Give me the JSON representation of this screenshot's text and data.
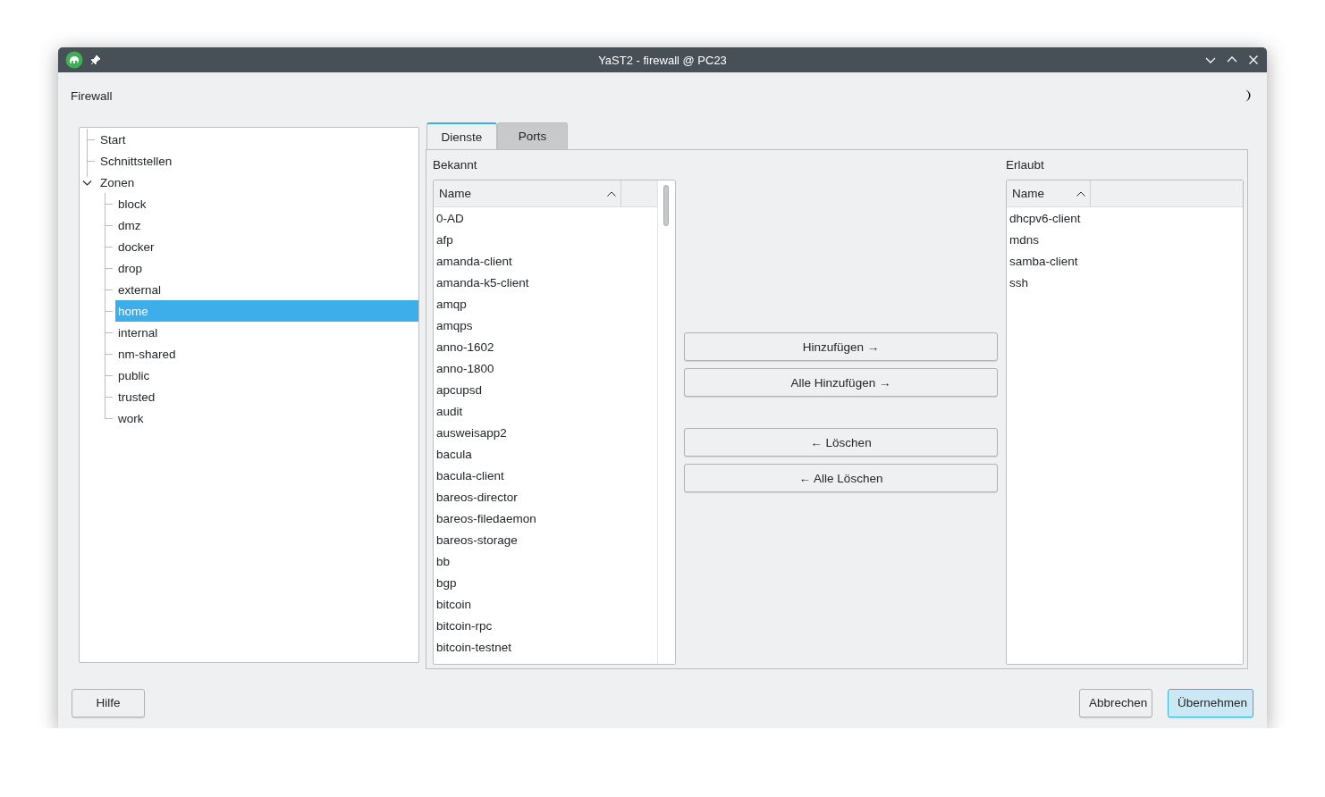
{
  "window": {
    "title": "YaST2 - firewall @ PC23"
  },
  "header": {
    "title": "Firewall"
  },
  "tree": [
    {
      "label": "Start",
      "selected": false
    },
    {
      "label": "Schnittstellen",
      "selected": false
    },
    {
      "label": "Zonen",
      "selected": false,
      "expanded": true,
      "children": [
        {
          "label": "block",
          "selected": false
        },
        {
          "label": "dmz",
          "selected": false
        },
        {
          "label": "docker",
          "selected": false
        },
        {
          "label": "drop",
          "selected": false
        },
        {
          "label": "external",
          "selected": false
        },
        {
          "label": "home",
          "selected": true
        },
        {
          "label": "internal",
          "selected": false
        },
        {
          "label": "nm-shared",
          "selected": false
        },
        {
          "label": "public",
          "selected": false
        },
        {
          "label": "trusted",
          "selected": false
        },
        {
          "label": "work",
          "selected": false
        }
      ]
    }
  ],
  "tabs": [
    {
      "label": "Dienste",
      "selected": true
    },
    {
      "label": "Ports",
      "selected": false
    }
  ],
  "known": {
    "label": "Bekannt",
    "column": "Name",
    "items": [
      {
        "label": "0-AD",
        "selected": false
      },
      {
        "label": "afp",
        "selected": false
      },
      {
        "label": "amanda-client",
        "selected": false
      },
      {
        "label": "amanda-k5-client",
        "selected": false
      },
      {
        "label": "amqp",
        "selected": false
      },
      {
        "label": "amqps",
        "selected": false
      },
      {
        "label": "anno-1602",
        "selected": false
      },
      {
        "label": "anno-1800",
        "selected": false
      },
      {
        "label": "apcupsd",
        "selected": false
      },
      {
        "label": "audit",
        "selected": false
      },
      {
        "label": "ausweisapp2",
        "selected": false
      },
      {
        "label": "bacula",
        "selected": false
      },
      {
        "label": "bacula-client",
        "selected": false
      },
      {
        "label": "bareos-director",
        "selected": false
      },
      {
        "label": "bareos-filedaemon",
        "selected": false
      },
      {
        "label": "bareos-storage",
        "selected": false
      },
      {
        "label": "bb",
        "selected": false
      },
      {
        "label": "bgp",
        "selected": false
      },
      {
        "label": "bitcoin",
        "selected": false
      },
      {
        "label": "bitcoin-rpc",
        "selected": false
      },
      {
        "label": "bitcoin-testnet",
        "selected": false
      }
    ]
  },
  "transfer_buttons": [
    {
      "label": "Hinzufügen →"
    },
    {
      "label": "Alle Hinzufügen →"
    },
    {
      "label": "← Löschen"
    },
    {
      "label": "← Alle Löschen"
    }
  ],
  "allowed": {
    "label": "Erlaubt",
    "column": "Name",
    "items": [
      {
        "label": "dhcpv6-client",
        "selected": false
      },
      {
        "label": "mdns",
        "selected": false
      },
      {
        "label": "samba-client",
        "selected": false
      },
      {
        "label": "ssh",
        "selected": false
      }
    ]
  },
  "footer_buttons": [
    {
      "label": "Hilfe",
      "default": false
    },
    {
      "label": "Abbrechen",
      "default": false
    },
    {
      "label": "Übernehmen",
      "default": true
    }
  ]
}
